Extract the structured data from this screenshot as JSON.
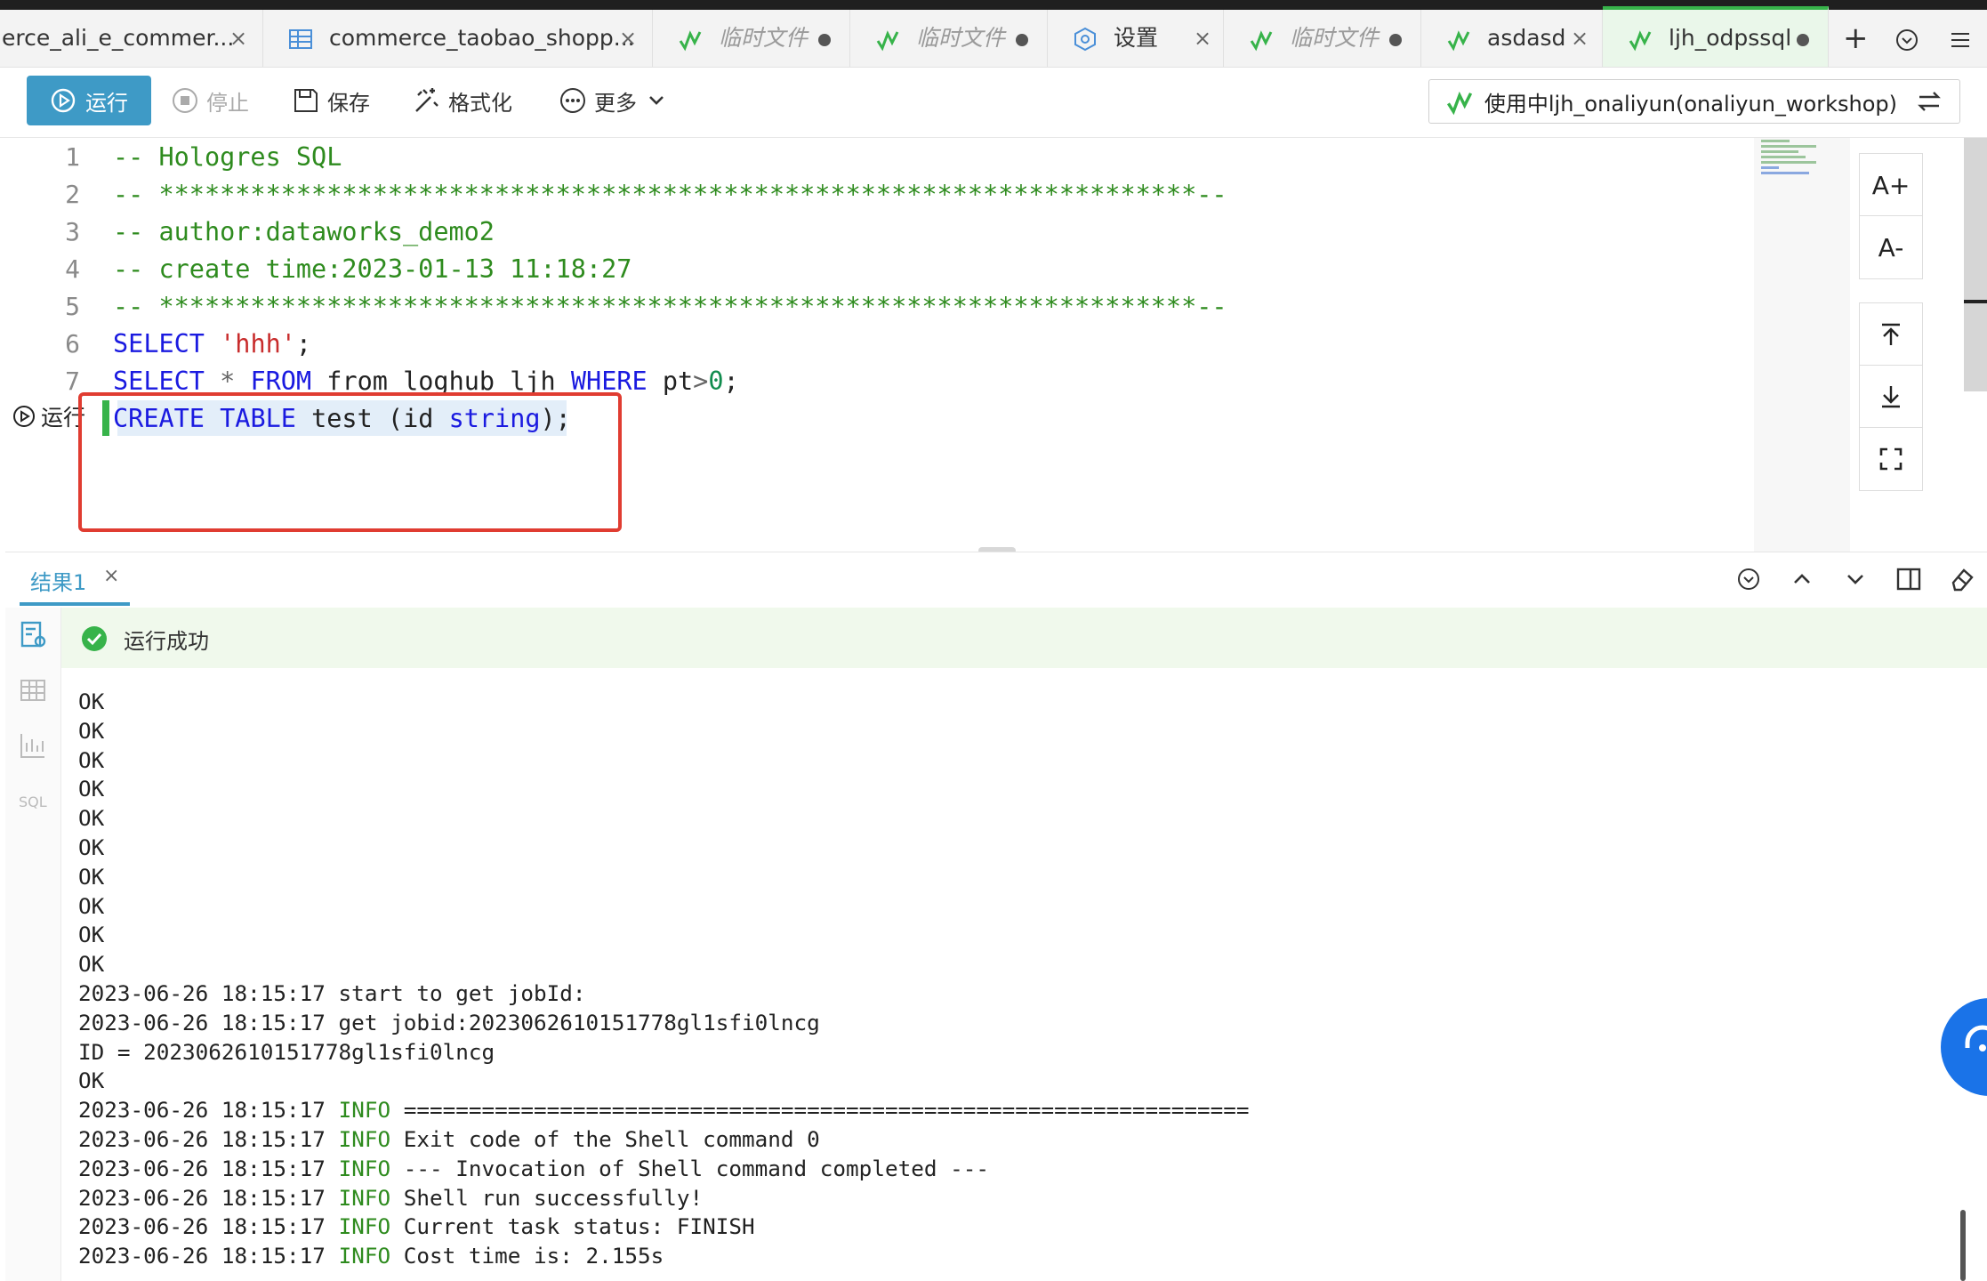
{
  "tabs": [
    {
      "label": "erce_ali_e_commer...",
      "icon": "none",
      "close": "×"
    },
    {
      "label": "commerce_taobao_shopp...",
      "icon": "table-icon",
      "close": "×"
    },
    {
      "label": "临时文件",
      "icon": "node-icon",
      "dot": true
    },
    {
      "label": "临时文件",
      "icon": "node-icon",
      "dot": true
    },
    {
      "label": "设置",
      "icon": "settings-icon",
      "close": "×"
    },
    {
      "label": "临时文件",
      "icon": "node-icon",
      "dot": true
    },
    {
      "label": "asdasd",
      "icon": "node-icon",
      "close": "×"
    },
    {
      "label": "ljh_odpssql",
      "icon": "node-icon",
      "dot": true,
      "active": true
    }
  ],
  "tabbar_actions": {
    "add": "+",
    "list": "chevron-down-circle-icon",
    "menu": "menu-icon"
  },
  "toolbar": {
    "run_label": "运行",
    "stop_label": "停止",
    "save_label": "保存",
    "format_label": "格式化",
    "more_label": "更多",
    "connection_label": "使用中ljh_onaliyun(onaliyun_workshop)"
  },
  "editor": {
    "line_numbers": [
      "1",
      "2",
      "3",
      "4",
      "5",
      "6",
      "7"
    ],
    "lines": [
      "-- Hologres SQL",
      "-- ********************************************************************--",
      "-- author:dataworks_demo2",
      "-- create time:2023-01-13 11:18:27",
      "-- ********************************************************************--",
      "SELECT 'hhh';",
      "SELECT * FROM from loghub ljh WHERE pt>0;",
      "CREATE TABLE test (id string);"
    ],
    "inline_run_label": "运行",
    "font_increase": "A+",
    "font_decrease": "A-"
  },
  "result": {
    "tab_label": "结果1",
    "tab_close": "×",
    "status_text": "运行成功",
    "log_lines": [
      "OK",
      "OK",
      "OK",
      "OK",
      "OK",
      "OK",
      "OK",
      "OK",
      "OK",
      "OK",
      "2023-06-26 18:15:17 start to get jobId:",
      "2023-06-26 18:15:17 get jobid:2023062610151778gl1sfi0lncg",
      "ID = 2023062610151778gl1sfi0lncg",
      "OK",
      "2023-06-26 18:15:17 INFO =================================================================",
      "2023-06-26 18:15:17 INFO Exit code of the Shell command 0",
      "2023-06-26 18:15:17 INFO --- Invocation of Shell command completed ---",
      "2023-06-26 18:15:17 INFO Shell run successfully!",
      "2023-06-26 18:15:17 INFO Current task status: FINISH",
      "2023-06-26 18:15:17 INFO Cost time is: 2.155s"
    ]
  },
  "colors": {
    "accent": "#3e9ac6",
    "green": "#37b34a",
    "highlight": "#e03c31",
    "keyword": "#1a1ae0",
    "comment": "#2e8b1e",
    "string": "#c82c2c"
  }
}
